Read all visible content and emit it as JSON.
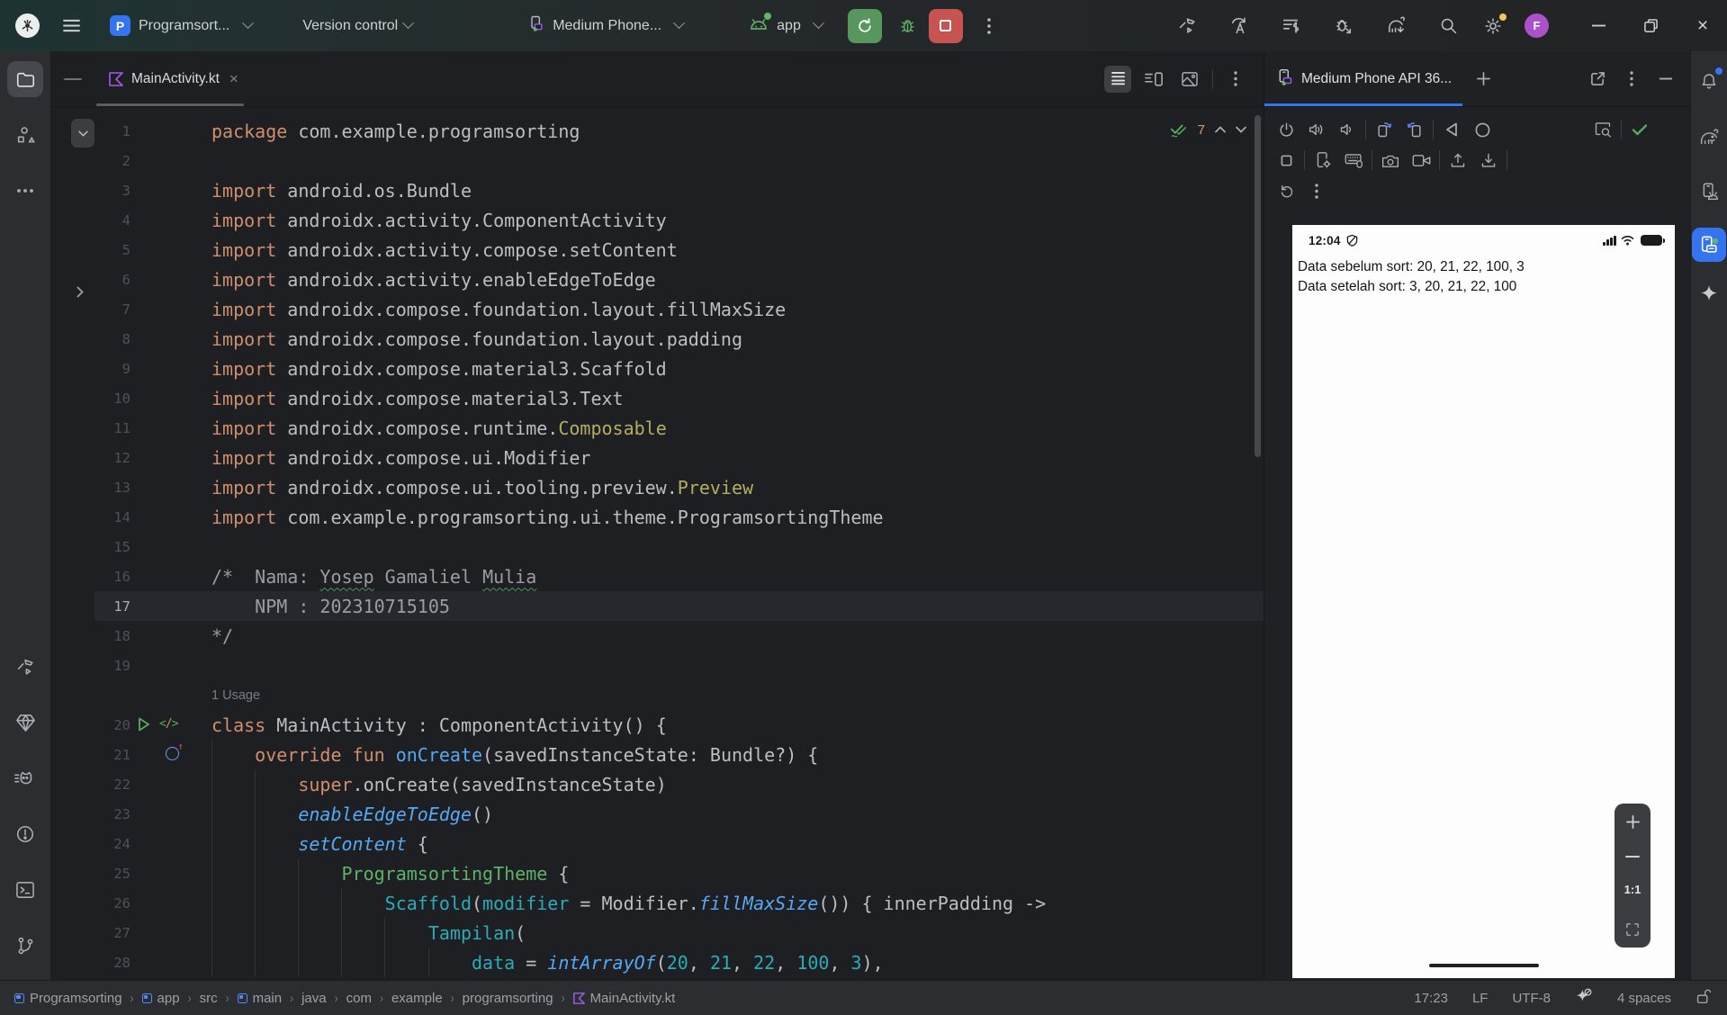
{
  "toolbar": {
    "project": {
      "initial": "P",
      "name": "Programsort..."
    },
    "version_control": "Version control",
    "device": "Medium Phone...",
    "run_config": "app",
    "avatar_initial": "F",
    "accent_colors": {
      "run_green": "#57965c",
      "stop_red": "#c75450",
      "project_blue": "#3574f0",
      "notification_yellow": "#f2c55c"
    },
    "icon_names": [
      "android-studio-logo",
      "hamburger-menu-icon",
      "project-chip",
      "chevron-down-icon",
      "device-phone-icon",
      "android-head-icon",
      "rerun-button",
      "debug-bug-icon",
      "stop-button",
      "more-vertical-icon",
      "build-hammer-icon",
      "apply-changes-icon",
      "profiler-icon",
      "attach-debugger-icon",
      "gradle-sync-icon",
      "search-icon",
      "settings-gear-icon",
      "user-avatar",
      "minimize-icon",
      "restore-icon",
      "close-icon"
    ]
  },
  "left_toolbar": {
    "icon_names": [
      "project-folder-icon",
      "structure-icon",
      "more-tool-windows-icon",
      "build-icon",
      "app-quality-insights-icon",
      "logcat-icon",
      "problems-icon",
      "terminal-icon",
      "version-control-branch-icon"
    ]
  },
  "right_toolbar": {
    "icon_names": [
      "notifications-bell-icon",
      "gradle-icon",
      "device-manager-icon",
      "running-devices-icon",
      "gemini-spark-icon"
    ]
  },
  "editor": {
    "tab": "MainActivity.kt",
    "inspections": {
      "count": "7"
    },
    "view_toggles": [
      "code-view",
      "split-view",
      "design-view"
    ],
    "code": {
      "rows": [
        {
          "n": "1",
          "s": [
            [
              "kw",
              "package"
            ],
            [
              "def",
              " com.example.programsorting"
            ]
          ]
        },
        {
          "n": "2",
          "s": []
        },
        {
          "n": "3",
          "s": [
            [
              "kw",
              "import"
            ],
            [
              "def",
              " android.os.Bundle"
            ]
          ]
        },
        {
          "n": "4",
          "s": [
            [
              "kw",
              "import"
            ],
            [
              "def",
              " androidx.activity.ComponentActivity"
            ]
          ]
        },
        {
          "n": "5",
          "s": [
            [
              "kw",
              "import"
            ],
            [
              "def",
              " androidx.activity.compose.setContent"
            ]
          ]
        },
        {
          "n": "6",
          "s": [
            [
              "kw",
              "import"
            ],
            [
              "def",
              " androidx.activity.enableEdgeToEdge"
            ]
          ]
        },
        {
          "n": "7",
          "s": [
            [
              "kw",
              "import"
            ],
            [
              "def",
              " androidx.compose.foundation.layout.fillMaxSize"
            ]
          ]
        },
        {
          "n": "8",
          "s": [
            [
              "kw",
              "import"
            ],
            [
              "def",
              " androidx.compose.foundation.layout.padding"
            ]
          ]
        },
        {
          "n": "9",
          "s": [
            [
              "kw",
              "import"
            ],
            [
              "def",
              " androidx.compose.material3.Scaffold"
            ]
          ]
        },
        {
          "n": "10",
          "s": [
            [
              "kw",
              "import"
            ],
            [
              "def",
              " androidx.compose.material3.Text"
            ]
          ]
        },
        {
          "n": "11",
          "s": [
            [
              "kw",
              "import"
            ],
            [
              "def",
              " androidx.compose.runtime."
            ],
            [
              "ann",
              "Composable"
            ]
          ]
        },
        {
          "n": "12",
          "s": [
            [
              "kw",
              "import"
            ],
            [
              "def",
              " androidx.compose.ui.Modifier"
            ]
          ]
        },
        {
          "n": "13",
          "s": [
            [
              "kw",
              "import"
            ],
            [
              "def",
              " androidx.compose.ui.tooling.preview."
            ],
            [
              "ann",
              "Preview"
            ]
          ]
        },
        {
          "n": "14",
          "s": [
            [
              "kw",
              "import"
            ],
            [
              "def",
              " com.example.programsorting.ui.theme.ProgramsortingTheme"
            ]
          ]
        },
        {
          "n": "15",
          "s": []
        },
        {
          "n": "16",
          "s": [
            [
              "cm",
              "/*  Nama: "
            ],
            [
              "cmu",
              "Yosep"
            ],
            [
              "cm",
              " Gamaliel "
            ],
            [
              "cmu",
              "Mulia"
            ]
          ]
        },
        {
          "n": "17",
          "hl": true,
          "s": [
            [
              "cm",
              "    NPM : 202310715105"
            ]
          ]
        },
        {
          "n": "18",
          "s": [
            [
              "cm",
              "*/"
            ]
          ]
        },
        {
          "n": "19",
          "s": []
        },
        {
          "inlay": "1 Usage"
        },
        {
          "n": "20",
          "g": "run",
          "s": [
            [
              "kw",
              "class"
            ],
            [
              "def",
              " MainActivity : ComponentActivity() {"
            ]
          ]
        },
        {
          "n": "21",
          "g": "override",
          "s": [
            [
              "def",
              "    "
            ],
            [
              "kw",
              "override"
            ],
            [
              "def",
              " "
            ],
            [
              "kw",
              "fun"
            ],
            [
              "def",
              " "
            ],
            [
              "fn",
              "onCreate"
            ],
            [
              "def",
              "(savedInstanceState: Bundle?) {"
            ]
          ]
        },
        {
          "n": "22",
          "s": [
            [
              "def",
              "        "
            ],
            [
              "kw",
              "super"
            ],
            [
              "def",
              ".onCreate(savedInstanceState)"
            ]
          ]
        },
        {
          "n": "23",
          "s": [
            [
              "def",
              "        "
            ],
            [
              "fni",
              "enableEdgeToEdge"
            ],
            [
              "def",
              "()"
            ]
          ]
        },
        {
          "n": "24",
          "s": [
            [
              "def",
              "        "
            ],
            [
              "fni",
              "setContent"
            ],
            [
              "def",
              " {"
            ]
          ]
        },
        {
          "n": "25",
          "s": [
            [
              "def",
              "            "
            ],
            [
              "compg",
              "ProgramsortingTheme"
            ],
            [
              "def",
              " {"
            ]
          ]
        },
        {
          "n": "26",
          "s": [
            [
              "def",
              "                "
            ],
            [
              "comp",
              "Scaffold"
            ],
            [
              "def",
              "("
            ],
            [
              "named",
              "modifier"
            ],
            [
              "def",
              " = Modifier."
            ],
            [
              "fni",
              "fillMaxSize"
            ],
            [
              "def",
              "()) { innerPadding ->"
            ]
          ]
        },
        {
          "n": "27",
          "s": [
            [
              "def",
              "                    "
            ],
            [
              "comp",
              "Tampilan"
            ],
            [
              "def",
              "("
            ]
          ]
        },
        {
          "n": "28",
          "s": [
            [
              "def",
              "                        "
            ],
            [
              "named",
              "data"
            ],
            [
              "def",
              " = "
            ],
            [
              "fni",
              "intArrayOf"
            ],
            [
              "def",
              "("
            ],
            [
              "num",
              "20"
            ],
            [
              "def",
              ", "
            ],
            [
              "num",
              "21"
            ],
            [
              "def",
              ", "
            ],
            [
              "num",
              "22"
            ],
            [
              "def",
              ", "
            ],
            [
              "num",
              "100"
            ],
            [
              "def",
              ", "
            ],
            [
              "num",
              "3"
            ],
            [
              "def",
              "),"
            ]
          ]
        }
      ],
      "syntax_colors": {
        "keyword": "#cf8e6d",
        "default": "#bcbec4",
        "comment": "#9a9da5",
        "annotation": "#b3ae60",
        "function": "#56a8f5",
        "composable_teal": "#2aacb8",
        "composable_green": "#5cb368",
        "number": "#2aacb8"
      }
    }
  },
  "devices_panel": {
    "tab": "Medium Phone API 36...",
    "zoom_label": "1:1",
    "header_icon_names": [
      "virtual-device-icon",
      "add-tab-icon",
      "open-in-window-icon",
      "more-vertical-icon",
      "hide-panel-icon"
    ],
    "emulator_toolbar_icon_names": [
      "power-icon",
      "volume-up-icon",
      "volume-down-icon",
      "rotate-left-icon",
      "rotate-right-icon",
      "back-icon",
      "home-icon",
      "screenshot-icon",
      "device-ok-check-icon",
      "overview-icon",
      "device-settings-icon",
      "virtual-keyboard-icon",
      "camera-icon",
      "record-video-icon",
      "upload-file-icon",
      "download-file-icon",
      "snapshot-restore-icon",
      "more-vertical-icon"
    ],
    "phone": {
      "time": "12:04",
      "status_icon_names": [
        "privacy-shield-icon",
        "signal-icon",
        "wifi-icon",
        "battery-icon"
      ],
      "line1": "Data sebelum sort: 20, 21, 22, 100, 3",
      "line2": "Data setelah sort: 3, 20, 21, 22, 100"
    }
  },
  "statusbar": {
    "breadcrumbs": [
      {
        "label": "Programsorting",
        "icon": "module"
      },
      {
        "label": "app",
        "icon": "module"
      },
      {
        "label": "src"
      },
      {
        "label": "main",
        "icon": "module"
      },
      {
        "label": "java"
      },
      {
        "label": "com"
      },
      {
        "label": "example"
      },
      {
        "label": "programsorting"
      },
      {
        "label": "MainActivity.kt",
        "icon": "kotlin"
      }
    ],
    "line_col": "17:23",
    "line_ending": "LF",
    "encoding": "UTF-8",
    "indent": "4 spaces",
    "icon_names": [
      "ai-assistant-off-icon",
      "lock-open-icon"
    ]
  }
}
